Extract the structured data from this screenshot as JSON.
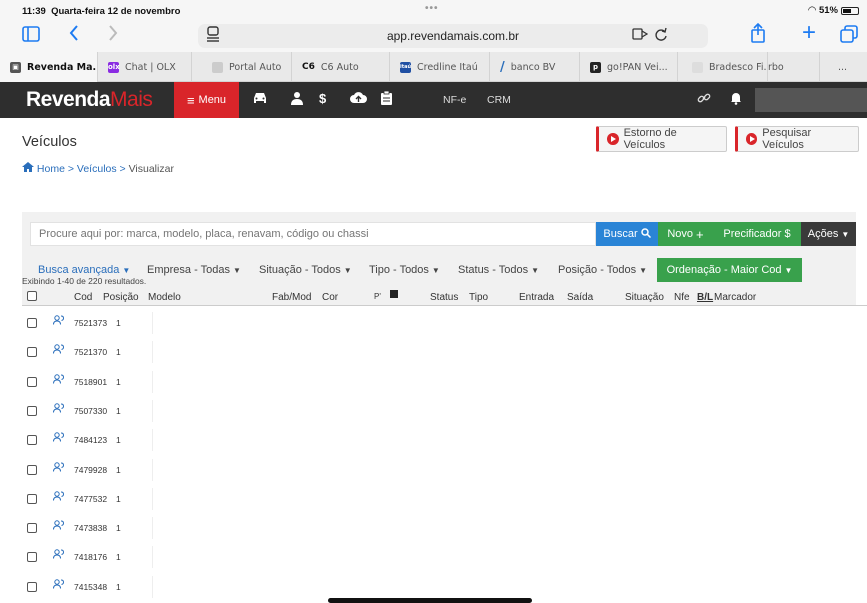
{
  "status_bar": {
    "time": "11:39",
    "date": "Quarta-feira 12 de novembro",
    "dots": "•••",
    "battery": "51%"
  },
  "browser": {
    "url": "app.revendamais.com.br",
    "icons": [
      "sidebar-icon",
      "back-icon",
      "forward-icon",
      "address-icon",
      "translate-icon",
      "reload-icon",
      "share-icon",
      "new-tab-icon",
      "tabs-icon"
    ],
    "tabs": [
      {
        "label": "Revenda Ma...",
        "color": "#2e2e2e",
        "fav": ""
      },
      {
        "label": "Chat | OLX",
        "color": "#8a2be2",
        "fav": "olx"
      },
      {
        "label": "Portal Auto",
        "color": "#bbbbbb",
        "fav": ""
      },
      {
        "label": "C6 Auto",
        "color": "#ffffff",
        "fav": "C6"
      },
      {
        "label": "Credline Itaú",
        "color": "#1f4fa3",
        "fav": "itaú"
      },
      {
        "label": "banco BV",
        "color": "#2a6ebb",
        "fav": "/"
      },
      {
        "label": "go!PAN Vei...",
        "color": "#222222",
        "fav": "p"
      },
      {
        "label": "Bradesco Fi...",
        "color": "#bbbbbb",
        "fav": ""
      },
      {
        "label": "rbo",
        "color": "",
        "fav": ""
      },
      {
        "label": "...",
        "color": "",
        "fav": ""
      }
    ]
  },
  "app": {
    "logo_a": "Revenda",
    "logo_b": "Mais",
    "menu_label": "Menu",
    "menu_icon": "≡",
    "nfe": "NF-e",
    "crm": "CRM",
    "accent": "#d9252a"
  },
  "page": {
    "title": "Veículos",
    "estorno": "Estorno de Veículos",
    "pesquisar": "Pesquisar Veículos",
    "breadcrumb": {
      "home": "Home",
      "sep": ">",
      "veiculos": "Veículos",
      "current": "Visualizar"
    }
  },
  "search": {
    "placeholder": "Procure aqui por: marca, modelo, placa, renavam, código ou chassi",
    "buscar": "Buscar",
    "novo": "Novo",
    "precificador": "Precificador $",
    "acoes": "Ações"
  },
  "filters": {
    "avancada": "Busca avançada",
    "empresa": "Empresa - Todas",
    "situacao": "Situação - Todos",
    "tipo": "Tipo - Todos",
    "status": "Status - Todos",
    "posicao": "Posição - Todos",
    "ordenacao": "Ordenação - Maior Cod"
  },
  "results": "Exibindo 1-40 de 220 resultados.",
  "columns": {
    "cod": "Cod",
    "posicao": "Posição",
    "modelo": "Modelo",
    "fabmod": "Fab/Mod",
    "cor": "Cor",
    "p": "P'",
    "status": "Status",
    "tipo": "Tipo",
    "entrada": "Entrada",
    "saida": "Saída",
    "situacao": "Situação",
    "nfe": "Nfe",
    "bl": "B/L",
    "marcador": "Marcador"
  },
  "rows": [
    {
      "cod": "7521373",
      "pos": "1"
    },
    {
      "cod": "7521370",
      "pos": "1"
    },
    {
      "cod": "7518901",
      "pos": "1"
    },
    {
      "cod": "7507330",
      "pos": "1"
    },
    {
      "cod": "7484123",
      "pos": "1"
    },
    {
      "cod": "7479928",
      "pos": "1"
    },
    {
      "cod": "7477532",
      "pos": "1"
    },
    {
      "cod": "7473838",
      "pos": "1"
    },
    {
      "cod": "7418176",
      "pos": "1"
    },
    {
      "cod": "7415348",
      "pos": "1"
    }
  ]
}
